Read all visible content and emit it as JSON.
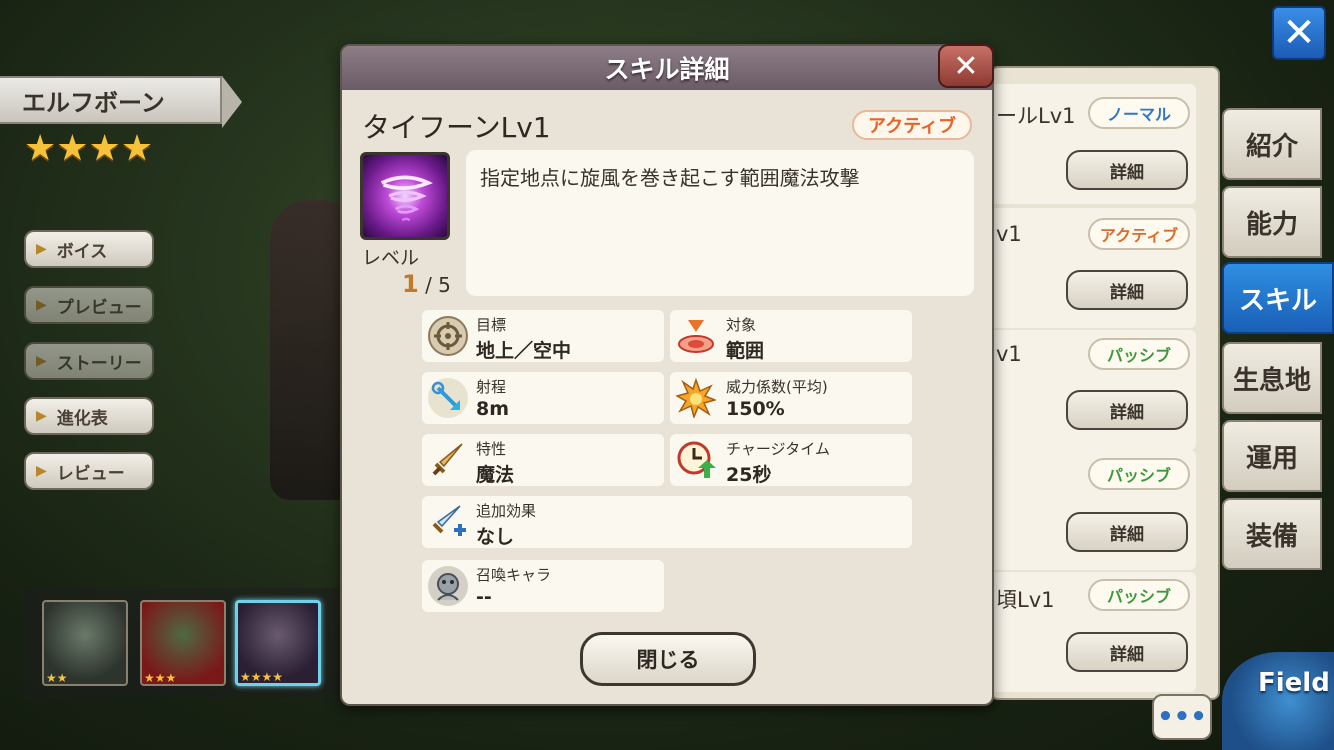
{
  "character": {
    "name": "エルフボーン",
    "stars": "★★★★",
    "side_buttons": [
      "ボイス",
      "プレビュー",
      "ストーリー",
      "進化表",
      "レビュー"
    ],
    "thumbnails": [
      {
        "stars": "★★"
      },
      {
        "stars": "★★★"
      },
      {
        "stars": "★★★★"
      }
    ]
  },
  "skill_list": [
    {
      "name": "ールLv1",
      "tag": "ノーマル",
      "tag_type": "normal",
      "detail": "詳細"
    },
    {
      "name": "v1",
      "tag": "アクティブ",
      "tag_type": "active",
      "detail": "詳細"
    },
    {
      "name": "v1",
      "tag": "パッシブ",
      "tag_type": "passive",
      "detail": "詳細"
    },
    {
      "name": "",
      "tag": "パッシブ",
      "tag_type": "passive",
      "detail": "詳細"
    },
    {
      "name": "頃Lv1",
      "tag": "パッシブ",
      "tag_type": "passive",
      "detail": "詳細"
    }
  ],
  "tabs": [
    "紹介",
    "能力",
    "スキル",
    "生息地",
    "運用",
    "装備"
  ],
  "active_tab": "スキル",
  "top_close": "✕",
  "chat": "•••",
  "field": "Field",
  "dialog": {
    "title": "スキル詳細",
    "close_icon": "✕",
    "skill_name": "タイフーンLv1",
    "type_tag": "アクティブ",
    "level_label": "レベル",
    "level_current": "1",
    "level_max": "/ 5",
    "description": "指定地点に旋風を巻き起こす範囲魔法攻撃",
    "stats": {
      "target_label": "目標",
      "target_value": "地上／空中",
      "scope_label": "対象",
      "scope_value": "範囲",
      "range_label": "射程",
      "range_value": "8m",
      "power_label": "威力係数(平均)",
      "power_value": "150%",
      "trait_label": "特性",
      "trait_value": "魔法",
      "charge_label": "チャージタイム",
      "charge_value": "25秒",
      "extra_label": "追加効果",
      "extra_value": "なし",
      "summon_label": "召喚キャラ",
      "summon_value": "--"
    },
    "close_button": "閉じる"
  },
  "colors": {
    "accent_blue": "#1a5fb8",
    "active_orange": "#e8622a",
    "passive_green": "#3b9a3b",
    "normal_blue": "#2f77c8"
  }
}
